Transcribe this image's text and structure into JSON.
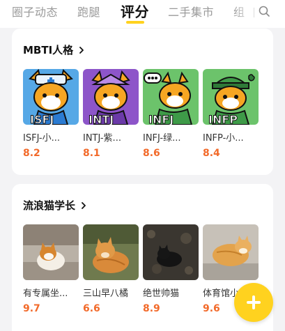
{
  "tabs": [
    {
      "label": "圈子动态",
      "active": false
    },
    {
      "label": "跑腿",
      "active": false
    },
    {
      "label": "评分",
      "active": true
    },
    {
      "label": "二手集市",
      "active": false
    },
    {
      "label": "组",
      "active": false
    }
  ],
  "sections": [
    {
      "title": "MBTI人格",
      "items": [
        {
          "name": "ISFJ-小...",
          "score": "8.2",
          "icon": "fox-isfj-avatar"
        },
        {
          "name": "INTJ-紫...",
          "score": "8.1",
          "icon": "fox-intj-avatar"
        },
        {
          "name": "INFJ-绿...",
          "score": "8.6",
          "icon": "fox-infj-avatar"
        },
        {
          "name": "INFP-小...",
          "score": "8.4",
          "icon": "fox-infp-avatar"
        }
      ]
    },
    {
      "title": "流浪猫学长",
      "items": [
        {
          "name": "有专属坐...",
          "score": "9.7",
          "icon": "cat-photo"
        },
        {
          "name": "三山早八橘",
          "score": "6.6",
          "icon": "cat-photo"
        },
        {
          "name": "绝世帅猫",
          "score": "8.9",
          "icon": "cat-photo"
        },
        {
          "name": "体育馆小",
          "score": "9.6",
          "icon": "cat-photo"
        }
      ]
    }
  ],
  "colors": {
    "accent": "#ffd21f",
    "score": "#f26a2a",
    "background": "#f3f3f5"
  }
}
